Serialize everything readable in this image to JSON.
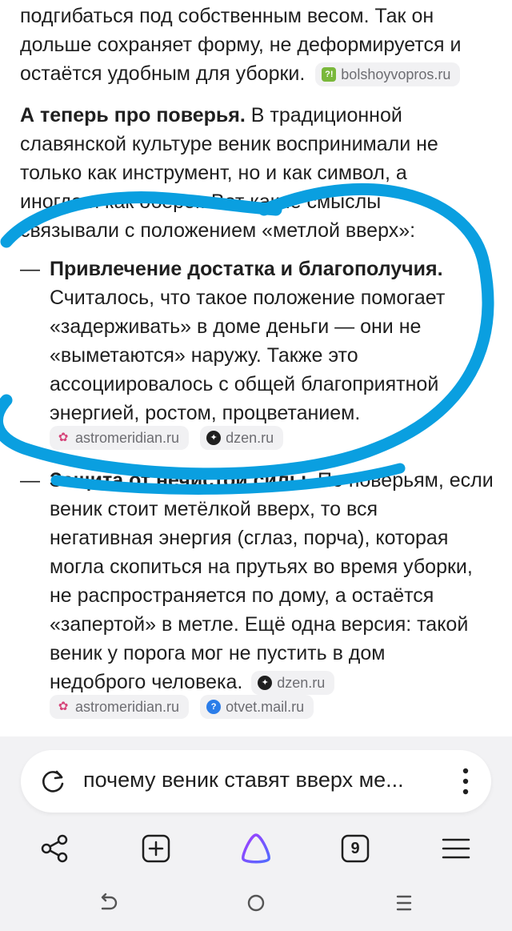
{
  "article": {
    "p1_lines": [
      "подгибаться под собственным весом. Так он",
      "дольше сохраняет форму, не деформируется и",
      "остаётся удобным для уборки."
    ],
    "p1_source": "bolshoyvopros.ru",
    "p2_bold": "А теперь про поверья.",
    "p2_lines": [
      " В традиционной",
      "славянской культуре веник воспринимали не",
      "только как инструмент, но и как символ, а",
      "иногда и как оберег. Вот какие смыслы",
      "связывали с положением «метлой вверх»:"
    ],
    "bullet1_dash": "—",
    "bullet1_bold": "Привлечение достатка и благополучия.",
    "bullet1_lines": [
      "Считалось, что такое положение помогает",
      "«задерживать» в доме деньги — они не",
      "«выметаются» наружу. Также это",
      "ассоциировалось с общей благоприятной",
      "энергией, ростом, процветанием."
    ],
    "bullet1_sources": [
      "astromeridian.ru",
      "dzen.ru"
    ],
    "bullet2_dash": "—",
    "bullet2_bold": "Защита от нечистой силы.",
    "bullet2_first": " По поверьям, если",
    "bullet2_lines": [
      "веник стоит метёлкой вверх, то вся",
      "негативная энергия (сглаз, порча), которая",
      "могла скопиться на прутьях во время уборки,",
      "не распространяется по дому, а остаётся",
      "«запертой» в метле. Ещё одна версия: такой",
      "веник у порога мог не пустить в дом",
      "недоброго человека."
    ],
    "bullet2_inline_source": "dzen.ru",
    "bullet2_sources": [
      "astromeridian.ru",
      "otvet.mail.ru"
    ]
  },
  "search": {
    "query": "почему веник ставят вверх ме..."
  },
  "toolbar": {
    "tabs_count": "9"
  },
  "colors": {
    "annotation": "#0a9fe0",
    "alice": "#7a5cff",
    "chip_bg": "#f1f1f3"
  }
}
